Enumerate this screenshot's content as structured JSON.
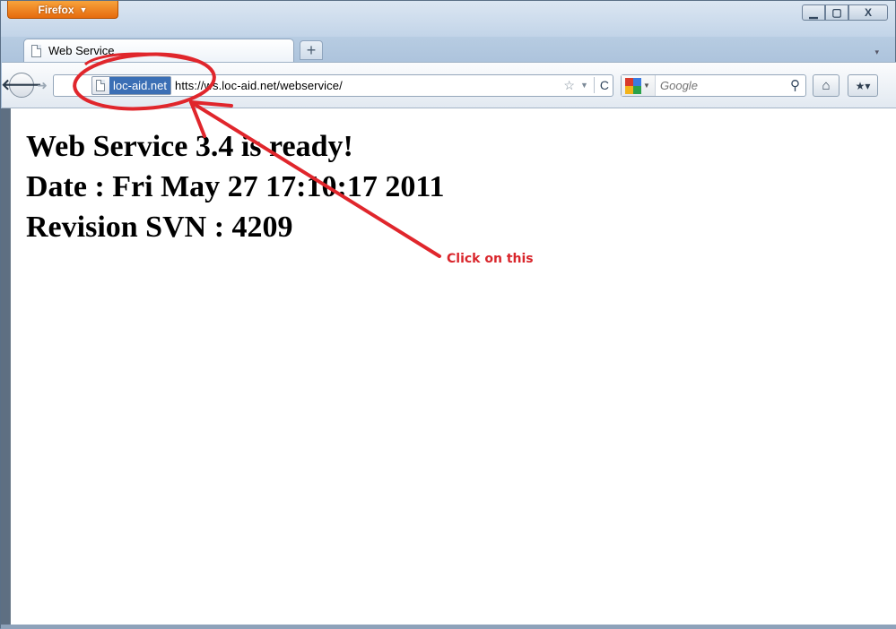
{
  "window": {
    "app_menu_label": "Firefox",
    "controls": {
      "minimize": "—",
      "maximize": "□",
      "close": "X"
    }
  },
  "tabs": [
    {
      "label": "Web Service",
      "active": true
    }
  ],
  "new_tab_label": "+",
  "navbar": {
    "site_identity": "loc-aid.net",
    "url": "https://ws.loc-aid.net/webservice/",
    "url_prefix": "htt",
    "url_rest": "s://ws.loc-aid.net/webservice/",
    "search_engine": "Google",
    "search_placeholder": "Google"
  },
  "content": {
    "lines": [
      "Web Service 3.4 is ready!",
      "Date : Fri May 27 17:10:17 2011",
      "Revision SVN : 4209"
    ]
  },
  "annotation": {
    "label": "Click on this",
    "color": "#d9262c"
  }
}
